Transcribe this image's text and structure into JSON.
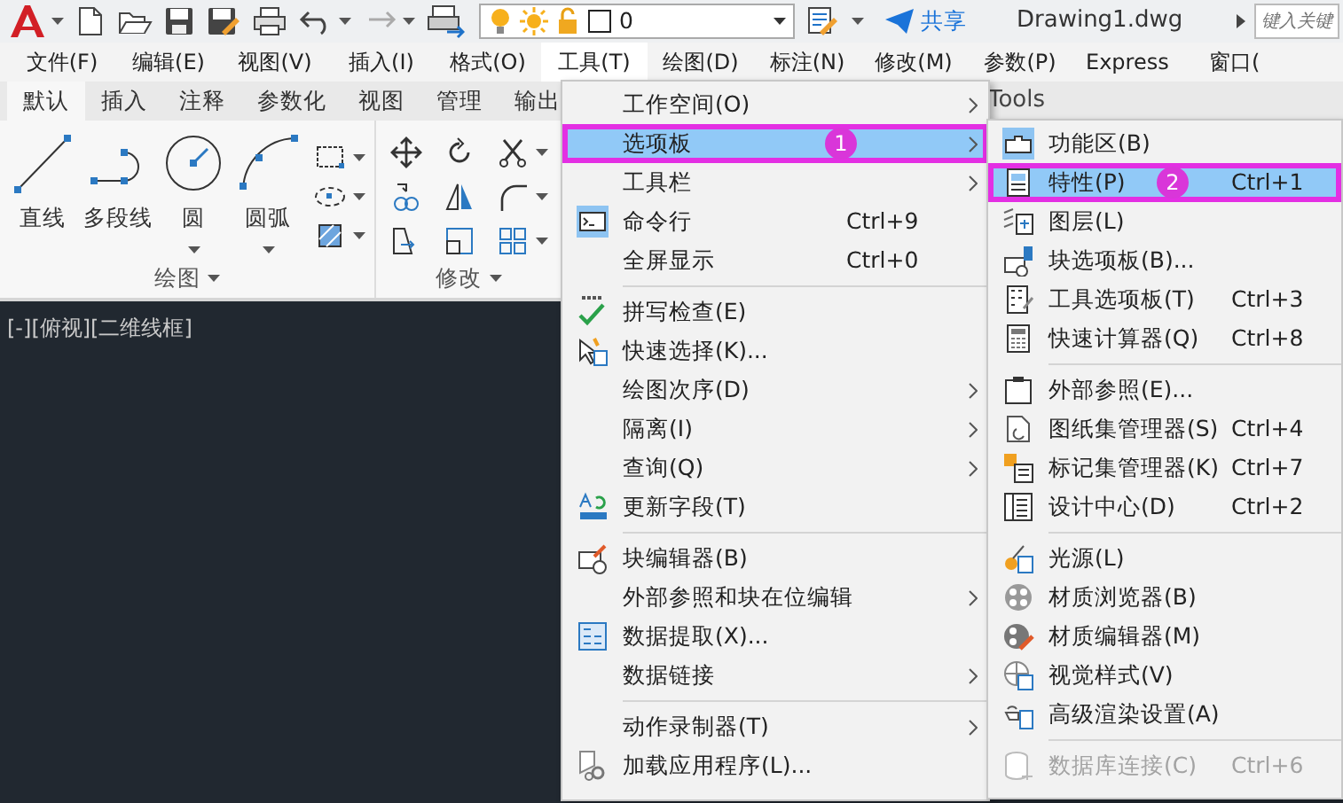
{
  "toolbar": {
    "layer": {
      "value": "0"
    },
    "share": "共享",
    "title": "Drawing1.dwg",
    "search": {
      "placeholder": "键入关键"
    }
  },
  "menubar": [
    {
      "label": "文件(F)",
      "selected": false
    },
    {
      "label": "编辑(E)",
      "selected": false
    },
    {
      "label": "视图(V)",
      "selected": false
    },
    {
      "label": "插入(I)",
      "selected": false
    },
    {
      "label": "格式(O)",
      "selected": false
    },
    {
      "label": "工具(T)",
      "selected": true
    },
    {
      "label": "绘图(D)",
      "selected": false
    },
    {
      "label": "标注(N)",
      "selected": false
    },
    {
      "label": "修改(M)",
      "selected": false
    },
    {
      "label": "参数(P)",
      "selected": false
    },
    {
      "label": "Express",
      "selected": false
    },
    {
      "label": "窗口(",
      "selected": false
    }
  ],
  "ribbon": {
    "tabs": [
      {
        "label": "默认",
        "selected": true
      },
      {
        "label": "插入",
        "selected": false
      },
      {
        "label": "注释",
        "selected": false
      },
      {
        "label": "参数化",
        "selected": false
      },
      {
        "label": "视图",
        "selected": false
      },
      {
        "label": "管理",
        "selected": false
      },
      {
        "label": "输出",
        "selected": false
      }
    ],
    "side_label": "Tools",
    "draw_panel": {
      "title": "绘图",
      "tools": [
        {
          "label": "直线",
          "has_menu": false
        },
        {
          "label": "多段线",
          "has_menu": false
        },
        {
          "label": "圆",
          "has_menu": true
        },
        {
          "label": "圆弧",
          "has_menu": true
        }
      ]
    },
    "modify_panel": {
      "title": "修改"
    }
  },
  "viewport": {
    "label": "[-][俯视][二维线框]"
  },
  "menu": {
    "items": [
      {
        "kind": "item",
        "label": "工作空间(O)",
        "has_submenu": true,
        "selected": false
      },
      {
        "kind": "item",
        "label": "选项板",
        "has_submenu": true,
        "selected": true,
        "callout": "1"
      },
      {
        "kind": "item",
        "label": "工具栏",
        "has_submenu": true,
        "selected": false
      },
      {
        "kind": "item",
        "label": "命令行",
        "shortcut": "Ctrl+9",
        "has_submenu": false,
        "selected": false
      },
      {
        "kind": "item",
        "label": "全屏显示",
        "shortcut": "Ctrl+0",
        "has_submenu": false,
        "selected": false
      },
      {
        "kind": "separator"
      },
      {
        "kind": "item",
        "label": "拼写检查(E)",
        "has_submenu": false,
        "selected": false
      },
      {
        "kind": "item",
        "label": "快速选择(K)...",
        "has_submenu": false,
        "selected": false
      },
      {
        "kind": "item",
        "label": "绘图次序(D)",
        "has_submenu": true,
        "selected": false
      },
      {
        "kind": "item",
        "label": "隔离(I)",
        "has_submenu": true,
        "selected": false
      },
      {
        "kind": "item",
        "label": "查询(Q)",
        "has_submenu": true,
        "selected": false
      },
      {
        "kind": "item",
        "label": "更新字段(T)",
        "has_submenu": false,
        "selected": false
      },
      {
        "kind": "separator"
      },
      {
        "kind": "item",
        "label": "块编辑器(B)",
        "has_submenu": false,
        "selected": false
      },
      {
        "kind": "item",
        "label": "外部参照和块在位编辑",
        "has_submenu": true,
        "selected": false
      },
      {
        "kind": "item",
        "label": "数据提取(X)...",
        "has_submenu": false,
        "selected": false
      },
      {
        "kind": "item",
        "label": "数据链接",
        "has_submenu": true,
        "selected": false
      },
      {
        "kind": "separator"
      },
      {
        "kind": "item",
        "label": "动作录制器(T)",
        "has_submenu": true,
        "selected": false
      },
      {
        "kind": "item",
        "label": "加载应用程序(L)...",
        "has_submenu": false,
        "selected": false
      }
    ]
  },
  "submenu": {
    "items": [
      {
        "kind": "item",
        "label": "功能区(B)",
        "selected": false,
        "disabled": false
      },
      {
        "kind": "item",
        "label": "特性(P)",
        "shortcut": "Ctrl+1",
        "selected": true,
        "disabled": false,
        "callout": "2"
      },
      {
        "kind": "item",
        "label": "图层(L)",
        "selected": false,
        "disabled": false
      },
      {
        "kind": "item",
        "label": "块选项板(B)...",
        "selected": false,
        "disabled": false
      },
      {
        "kind": "item",
        "label": "工具选项板(T)",
        "shortcut": "Ctrl+3",
        "selected": false,
        "disabled": false
      },
      {
        "kind": "item",
        "label": "快速计算器(Q)",
        "shortcut": "Ctrl+8",
        "selected": false,
        "disabled": false
      },
      {
        "kind": "separator"
      },
      {
        "kind": "item",
        "label": "外部参照(E)...",
        "selected": false,
        "disabled": false
      },
      {
        "kind": "item",
        "label": "图纸集管理器(S)",
        "shortcut": "Ctrl+4",
        "selected": false,
        "disabled": false
      },
      {
        "kind": "item",
        "label": "标记集管理器(K)",
        "shortcut": "Ctrl+7",
        "selected": false,
        "disabled": false
      },
      {
        "kind": "item",
        "label": "设计中心(D)",
        "shortcut": "Ctrl+2",
        "selected": false,
        "disabled": false
      },
      {
        "kind": "separator"
      },
      {
        "kind": "item",
        "label": "光源(L)",
        "selected": false,
        "disabled": false
      },
      {
        "kind": "item",
        "label": "材质浏览器(B)",
        "selected": false,
        "disabled": false
      },
      {
        "kind": "item",
        "label": "材质编辑器(M)",
        "selected": false,
        "disabled": false
      },
      {
        "kind": "item",
        "label": "视觉样式(V)",
        "selected": false,
        "disabled": false
      },
      {
        "kind": "item",
        "label": "高级渲染设置(A)",
        "selected": false,
        "disabled": false
      },
      {
        "kind": "separator"
      },
      {
        "kind": "item",
        "label": "数据库连接(C)",
        "shortcut": "Ctrl+6",
        "selected": false,
        "disabled": true
      }
    ]
  }
}
